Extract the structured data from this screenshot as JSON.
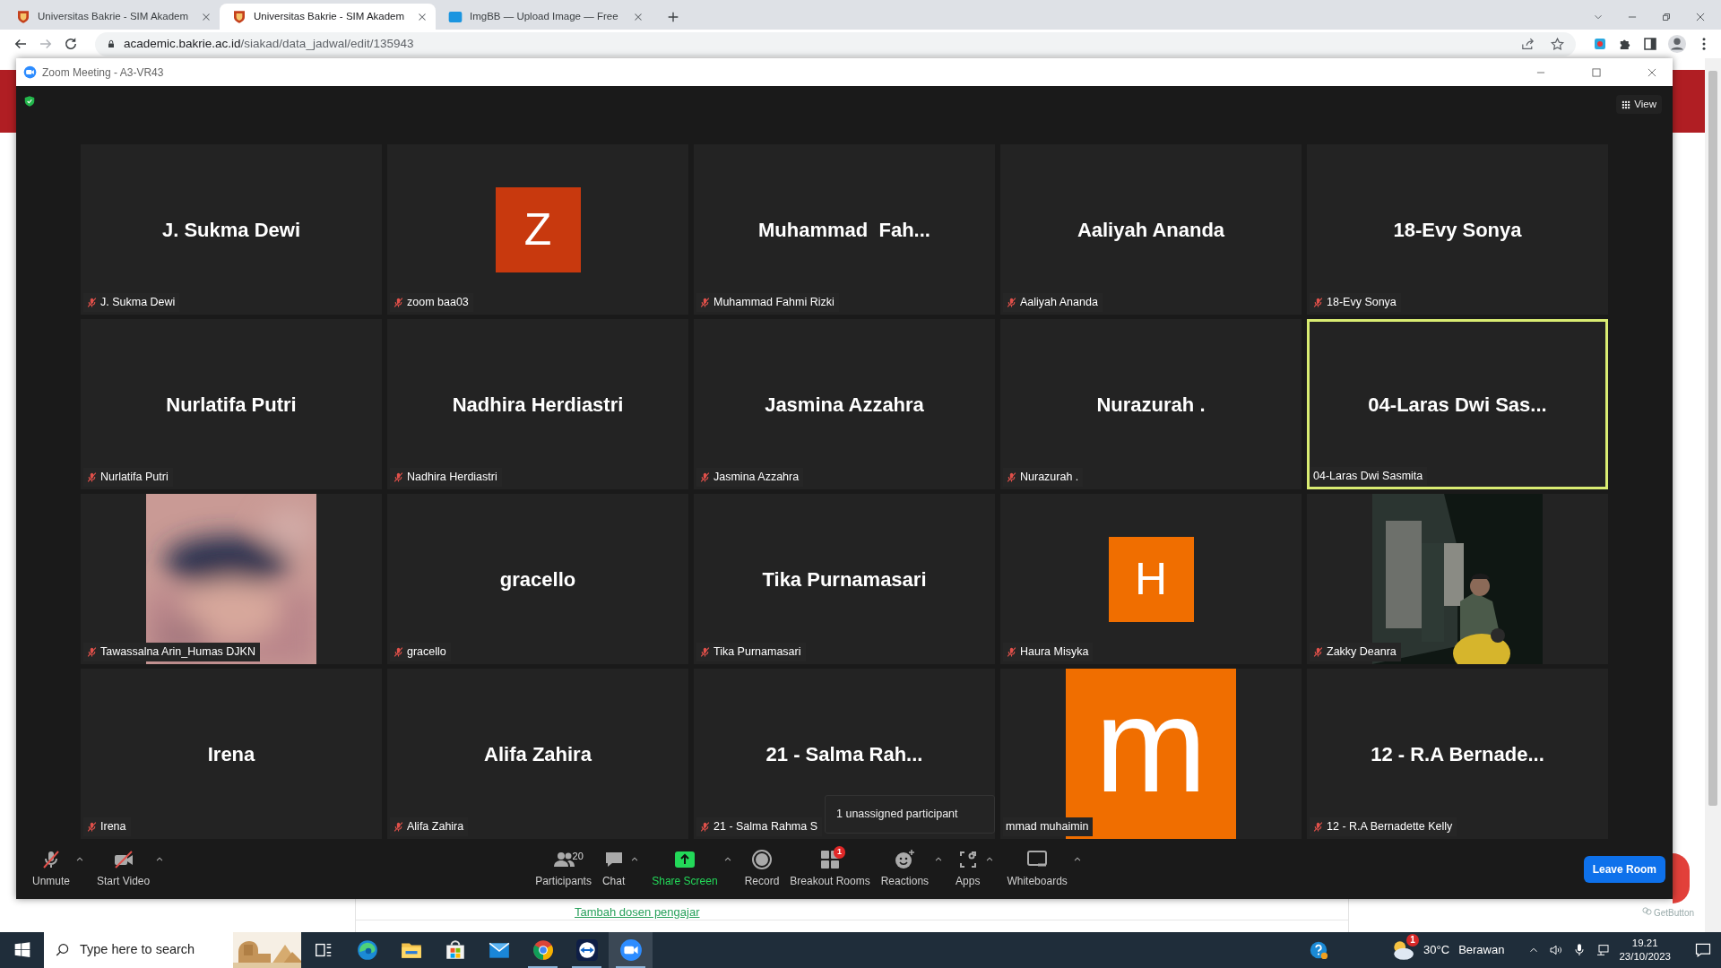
{
  "browser": {
    "tabs": [
      {
        "title": "Universitas Bakrie - SIM Akadem",
        "kind": "shield",
        "selected": false
      },
      {
        "title": "Universitas Bakrie - SIM Akadem",
        "kind": "shield",
        "selected": true
      },
      {
        "title": "ImgBB — Upload Image — Free",
        "kind": "square",
        "selected": false
      }
    ],
    "address": {
      "host": "academic.bakrie.ac.id",
      "path": "/siakad/data_jadwal/edit/135943"
    }
  },
  "page": {
    "link": "Tambah dosen pengajar",
    "widget": "GetButton"
  },
  "zoom": {
    "title": "Zoom Meeting - A3-VR43",
    "view_button": "View",
    "tiles": [
      {
        "kind": "name",
        "title": "J. Sukma Dewi",
        "label": "J. Sukma Dewi",
        "muted": true,
        "selected": false
      },
      {
        "kind": "avatar",
        "letter": "Z",
        "color": "#c8390e",
        "label": "zoom baa03",
        "muted": true,
        "selected": false
      },
      {
        "kind": "name",
        "title": "Muhammad  Fah...",
        "label": "Muhammad Fahmi Rizki",
        "muted": true,
        "selected": false
      },
      {
        "kind": "name",
        "title": "Aaliyah Ananda",
        "label": "Aaliyah Ananda",
        "muted": true,
        "selected": false
      },
      {
        "kind": "name",
        "title": "18-Evy Sonya",
        "label": "18-Evy Sonya",
        "muted": true,
        "selected": false
      },
      {
        "kind": "name",
        "title": "Nurlatifa Putri",
        "label": "Nurlatifa Putri",
        "muted": true,
        "selected": false
      },
      {
        "kind": "name",
        "title": "Nadhira Herdiastri",
        "label": "Nadhira Herdiastri",
        "muted": true,
        "selected": false
      },
      {
        "kind": "name",
        "title": "Jasmina Azzahra",
        "label": "Jasmina Azzahra",
        "muted": true,
        "selected": false
      },
      {
        "kind": "name",
        "title": "Nurazurah .",
        "label": "Nurazurah .",
        "muted": true,
        "selected": false
      },
      {
        "kind": "name",
        "title": "04-Laras Dwi Sas...",
        "label": "04-Laras Dwi Sasmita",
        "muted": false,
        "selected": true
      },
      {
        "label": "Tawassalna Arin_Humas DJKN",
        "muted": true,
        "selected": false
      },
      {
        "kind": "name",
        "title": "gracello",
        "label": "gracello",
        "muted": true,
        "selected": false
      },
      {
        "kind": "name",
        "title": "Tika Purnamasari",
        "label": "Tika Purnamasari",
        "muted": true,
        "selected": false
      },
      {
        "kind": "avatar",
        "letter": "H",
        "color": "#f06e00",
        "label": "Haura Misyka",
        "muted": true,
        "selected": false
      },
      {
        "label": "Zakky Deanra",
        "muted": true,
        "selected": false
      },
      {
        "kind": "name",
        "title": "Irena",
        "label": "Irena",
        "muted": true,
        "selected": false
      },
      {
        "kind": "name",
        "title": "Alifa Zahira",
        "label": "Alifa Zahira",
        "muted": true,
        "selected": false
      },
      {
        "kind": "name",
        "title": "21 - Salma Rah...",
        "label": "21 - Salma Rahma S",
        "muted": true,
        "selected": false
      },
      {
        "kind": "bigavatar",
        "letter": "m",
        "color": "#f06e00",
        "label": "mmad muhaimin",
        "muted": false,
        "selected": false
      },
      {
        "kind": "name",
        "title": "12 - R.A Bernade...",
        "label": "12 - R.A Bernadette Kelly",
        "muted": true,
        "selected": false
      }
    ],
    "tooltip": "1 unassigned participant",
    "toolbar_left": [
      {
        "kind": "mic",
        "label": "Unmute",
        "caret": true
      },
      {
        "kind": "video",
        "label": "Start Video",
        "caret": true
      }
    ],
    "toolbar": [
      {
        "kind": "participants",
        "label": "Participants",
        "count": "20",
        "caret": false
      },
      {
        "kind": "chat",
        "label": "Chat",
        "caret": true
      },
      {
        "kind": "share",
        "label": "Share Screen",
        "caret": true
      },
      {
        "kind": "record",
        "label": "Record",
        "caret": false
      },
      {
        "kind": "breakout",
        "label": "Breakout Rooms",
        "badge": "1",
        "caret": false
      },
      {
        "kind": "reactions",
        "label": "Reactions",
        "caret": true
      },
      {
        "kind": "apps",
        "label": "Apps",
        "caret": true
      },
      {
        "kind": "whiteboard",
        "label": "Whiteboards",
        "caret": true
      }
    ],
    "leave_button": "Leave Room"
  },
  "taskbar": {
    "search_placeholder": "Type here to search",
    "apps": [
      {
        "kind": "taskview",
        "running": false,
        "selected": false
      },
      {
        "kind": "edge",
        "running": false,
        "selected": false
      },
      {
        "kind": "folder",
        "running": false,
        "selected": false
      },
      {
        "kind": "store",
        "running": false,
        "selected": false
      },
      {
        "kind": "mail",
        "running": false,
        "selected": false
      },
      {
        "kind": "chrome",
        "running": true,
        "selected": false
      },
      {
        "kind": "teamviewer",
        "running": true,
        "selected": false
      },
      {
        "kind": "zoom",
        "running": true,
        "selected": true
      }
    ],
    "weather": {
      "temp": "30°C",
      "condition": "Berawan",
      "badge": "1"
    },
    "clock": {
      "time": "19.21",
      "date": "23/10/2023"
    }
  }
}
